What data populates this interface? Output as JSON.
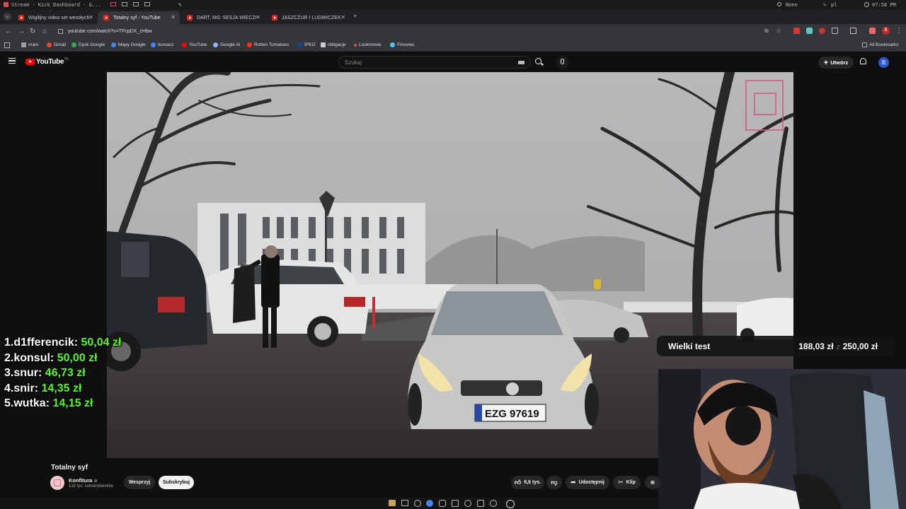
{
  "os_bar": {
    "window_title": "Stream - Kick Dashboard - G...",
    "status": "None",
    "lang": "pl",
    "time": "07:58 PM"
  },
  "tabs": [
    {
      "label": "Wigilijny video set wesołych",
      "active": false
    },
    {
      "label": "Totalny syf - YouTube",
      "active": true
    },
    {
      "label": "DART, MŚ: SESJA WIECZORNA",
      "active": false
    },
    {
      "label": "JASZCZUR I LUDWICZEK O",
      "active": false
    }
  ],
  "address_bar": {
    "url": "youtube.com/watch?v=TFcpDX_cHbw"
  },
  "bookmarks": [
    {
      "label": "main",
      "color": "#9aa0a6"
    },
    {
      "label": "Gmail",
      "color": "#ea4335"
    },
    {
      "label": "Dysk Google",
      "color": "#34a853"
    },
    {
      "label": "Mapy Google",
      "color": "#4285f4"
    },
    {
      "label": "tlumacz",
      "color": "#4285f4"
    },
    {
      "label": "YouTube",
      "color": "#ff0000"
    },
    {
      "label": "Google AI",
      "color": "#8ab4f8"
    },
    {
      "label": "Rotten Tomatoes",
      "color": "#fa320a"
    },
    {
      "label": "IPKO",
      "color": "#1e3f8a"
    },
    {
      "label": "obligacje",
      "color": "#cccccc"
    },
    {
      "label": "Lookmovie",
      "color": "#e84a4a"
    },
    {
      "label": "Fmovies",
      "color": "#4fc3f7"
    }
  ],
  "all_bookmarks_label": "All Bookmarks",
  "youtube": {
    "logo": "YouTube",
    "country": "PL",
    "search_placeholder": "Szukaj",
    "create_label": "Utwórz",
    "avatar_letter": "B"
  },
  "video": {
    "title": "Totalny syf",
    "plate": "EZG 97619"
  },
  "channel": {
    "name": "Konfitura",
    "subscribers": "132 tys. subskrybentów",
    "support_label": "Wesprzyj",
    "subscribe_label": "Subskrybuj"
  },
  "actions": {
    "likes": "6,6 tys.",
    "share_label": "Udostępnij",
    "clip_label": "Klip"
  },
  "leaderboard": [
    {
      "rank": "1.",
      "name": "d1fferencik:",
      "amount": "50,04 zł"
    },
    {
      "rank": "2.",
      "name": "konsul:",
      "amount": "50,00 zł"
    },
    {
      "rank": "3.",
      "name": "snur:",
      "amount": "46,73 zł"
    },
    {
      "rank": "4.",
      "name": "snir:",
      "amount": "14,35 zł"
    },
    {
      "rank": "5.",
      "name": "wutka:",
      "amount": "14,15 zł"
    }
  ],
  "goal": {
    "title": "Wielki test",
    "current": "188,03 zł",
    "sep": "z",
    "target": "250,00 zł"
  },
  "colors": {
    "donation_green": "#53fc18",
    "yt_red": "#ff0000",
    "page_bg": "#0f0f0f"
  }
}
